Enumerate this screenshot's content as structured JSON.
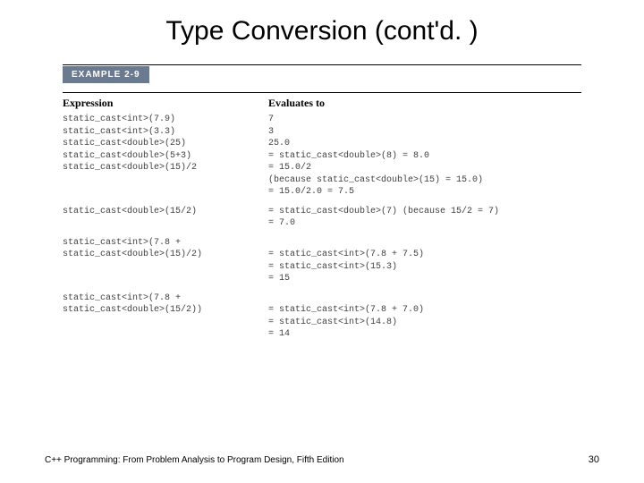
{
  "title": "Type Conversion (cont'd. )",
  "exampleLabel": "EXAMPLE 2-9",
  "headers": {
    "expression": "Expression",
    "evaluates": "Evaluates to"
  },
  "rows": [
    {
      "expr": "static_cast<int>(7.9)",
      "eval": "7",
      "spaced": false
    },
    {
      "expr": "static_cast<int>(3.3)",
      "eval": "3",
      "spaced": false
    },
    {
      "expr": "static_cast<double>(25)",
      "eval": "25.0",
      "spaced": false
    },
    {
      "expr": "static_cast<double>(5+3)",
      "eval": "= static_cast<double>(8) = 8.0",
      "spaced": false
    },
    {
      "expr": "static_cast<double>(15)/2",
      "eval": "= 15.0/2",
      "spaced": false
    },
    {
      "expr": "",
      "eval": "(because static_cast<double>(15) = 15.0)",
      "spaced": false
    },
    {
      "expr": "",
      "eval": "= 15.0/2.0 = 7.5",
      "spaced": false
    },
    {
      "expr": "static_cast<double>(15/2)",
      "eval": "= static_cast<double>(7) (because 15/2 = 7)",
      "spaced": true
    },
    {
      "expr": "",
      "eval": "= 7.0",
      "spaced": false
    },
    {
      "expr": "static_cast<int>(7.8 +",
      "eval": "",
      "spaced": true
    },
    {
      "expr": "static_cast<double>(15)/2)",
      "eval": "= static_cast<int>(7.8 + 7.5)",
      "spaced": false
    },
    {
      "expr": "",
      "eval": "= static_cast<int>(15.3)",
      "spaced": false
    },
    {
      "expr": "",
      "eval": "= 15",
      "spaced": false
    },
    {
      "expr": "static_cast<int>(7.8 +",
      "eval": "",
      "spaced": true
    },
    {
      "expr": "static_cast<double>(15/2))",
      "eval": "= static_cast<int>(7.8 + 7.0)",
      "spaced": false
    },
    {
      "expr": "",
      "eval": "= static_cast<int>(14.8)",
      "spaced": false
    },
    {
      "expr": "",
      "eval": "= 14",
      "spaced": false
    }
  ],
  "footer": "C++ Programming: From Problem Analysis to Program Design, Fifth Edition",
  "pageNumber": "30"
}
